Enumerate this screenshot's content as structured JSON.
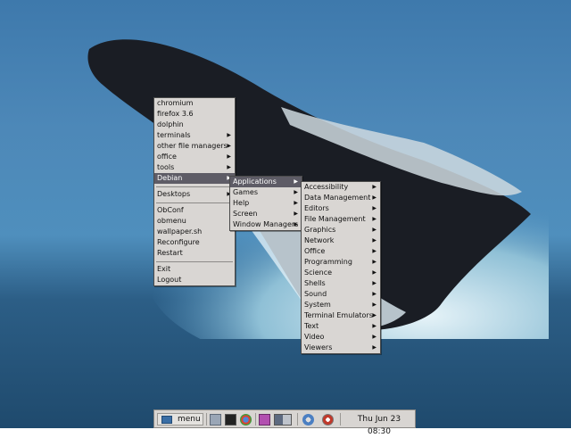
{
  "colors": {
    "menu_bg": "#d9d6d3",
    "highlight_bg": "#5e5c66",
    "desktop_sky": "#3e79ac",
    "taskbar_bg": "#d8d5d2"
  },
  "root_menu": {
    "items": [
      {
        "label": "chromium",
        "submenu": false
      },
      {
        "label": "firefox 3.6",
        "submenu": false
      },
      {
        "label": "dolphin",
        "submenu": false
      },
      {
        "label": "terminals",
        "submenu": true
      },
      {
        "label": "other file managers",
        "submenu": true
      },
      {
        "label": "office",
        "submenu": true
      },
      {
        "label": "tools",
        "submenu": true
      },
      {
        "label": "Debian",
        "submenu": true,
        "active": true
      },
      {
        "label": "Desktops",
        "submenu": true
      },
      {
        "label": "ObConf",
        "submenu": false
      },
      {
        "label": "obmenu",
        "submenu": false
      },
      {
        "label": "wallpaper.sh",
        "submenu": false
      },
      {
        "label": "Reconfigure",
        "submenu": false
      },
      {
        "label": "Restart",
        "submenu": false
      },
      {
        "label": "Exit",
        "submenu": false
      },
      {
        "label": "Logout",
        "submenu": false
      }
    ]
  },
  "debian_menu": {
    "items": [
      {
        "label": "Applications",
        "submenu": true,
        "active": true
      },
      {
        "label": "Games",
        "submenu": true
      },
      {
        "label": "Help",
        "submenu": true
      },
      {
        "label": "Screen",
        "submenu": true
      },
      {
        "label": "Window Managers",
        "submenu": true
      }
    ]
  },
  "applications_menu": {
    "items": [
      {
        "label": "Accessibility"
      },
      {
        "label": "Data Management"
      },
      {
        "label": "Editors"
      },
      {
        "label": "File Management"
      },
      {
        "label": "Graphics"
      },
      {
        "label": "Network"
      },
      {
        "label": "Office"
      },
      {
        "label": "Programming"
      },
      {
        "label": "Science"
      },
      {
        "label": "Shells"
      },
      {
        "label": "Sound"
      },
      {
        "label": "System"
      },
      {
        "label": "Terminal Emulators"
      },
      {
        "label": "Text"
      },
      {
        "label": "Video"
      },
      {
        "label": "Viewers"
      }
    ]
  },
  "taskbar": {
    "menu_label": "menu",
    "clock": "Thu Jun 23  08:30",
    "launchers": [
      "file-manager-icon",
      "terminal-icon",
      "chromium-icon",
      "image-viewer-icon",
      "workspace-pager-icon",
      "network-icon",
      "settings-icon"
    ]
  }
}
